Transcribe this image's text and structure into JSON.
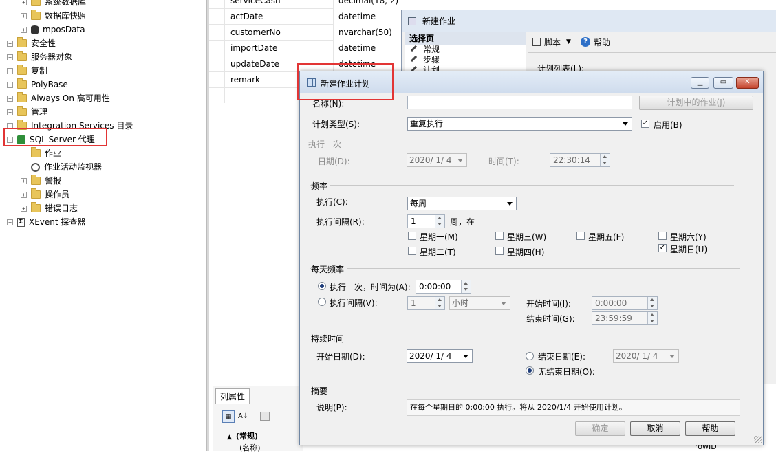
{
  "tree": {
    "items": [
      {
        "label": "系统数据库",
        "indent": 1,
        "icon": "folder",
        "expand": "+"
      },
      {
        "label": "数据库快照",
        "indent": 1,
        "icon": "folder",
        "expand": "+"
      },
      {
        "label": "mposData",
        "indent": 1,
        "icon": "database",
        "expand": "+"
      },
      {
        "label": "安全性",
        "indent": 0,
        "icon": "folder",
        "expand": "+"
      },
      {
        "label": "服务器对象",
        "indent": 0,
        "icon": "folder",
        "expand": "+"
      },
      {
        "label": "复制",
        "indent": 0,
        "icon": "folder",
        "expand": "+"
      },
      {
        "label": "PolyBase",
        "indent": 0,
        "icon": "folder",
        "expand": "+"
      },
      {
        "label": "Always On 高可用性",
        "indent": 0,
        "icon": "folder",
        "expand": "+"
      },
      {
        "label": "管理",
        "indent": 0,
        "icon": "folder",
        "expand": "+"
      },
      {
        "label": "Integration Services 目录",
        "indent": 0,
        "icon": "folder",
        "expand": "+"
      },
      {
        "label": "SQL Server 代理",
        "indent": 0,
        "icon": "agent",
        "expand": "-"
      },
      {
        "label": "作业",
        "indent": 1,
        "icon": "folder",
        "expand": ""
      },
      {
        "label": "作业活动监视器",
        "indent": 1,
        "icon": "monitor",
        "expand": ""
      },
      {
        "label": "警报",
        "indent": 1,
        "icon": "folder",
        "expand": "+"
      },
      {
        "label": "操作员",
        "indent": 1,
        "icon": "folder",
        "expand": "+"
      },
      {
        "label": "错误日志",
        "indent": 1,
        "icon": "folder",
        "expand": "+"
      },
      {
        "label": "XEvent 探查器",
        "indent": 0,
        "icon": "xevent",
        "expand": "+"
      }
    ]
  },
  "grid": {
    "rows": [
      {
        "name": "serviceCash",
        "type": "decimal(18, 2)"
      },
      {
        "name": "actDate",
        "type": "datetime"
      },
      {
        "name": "customerNo",
        "type": "nvarchar(50)"
      },
      {
        "name": "importDate",
        "type": "datetime"
      },
      {
        "name": "updateDate",
        "type": "datetime"
      },
      {
        "name": "remark",
        "type": ""
      }
    ]
  },
  "back_dialog": {
    "title": "新建作业",
    "select_page": "选择页",
    "pages": [
      "常规",
      "步骤",
      "计划"
    ],
    "toolbar_script": "脚本",
    "toolbar_help": "帮助",
    "schedule_list": "计划列表(L):"
  },
  "props": {
    "tab": "列属性",
    "section": "(常规)",
    "name_row": "(名称)",
    "right_value": "rowID"
  },
  "dialog": {
    "title": "新建作业计划",
    "name_label": "名称(N):",
    "name_value": "",
    "jobs_in_schedule": "计划中的作业(J)",
    "schedule_type_label": "计划类型(S):",
    "schedule_type_value": "重复执行",
    "enabled_label": "启用(B)",
    "enabled_checked": true,
    "once_group": "执行一次",
    "once_date_label": "日期(D):",
    "once_date_value": "2020/ 1/ 4",
    "once_time_label": "时间(T):",
    "once_time_value": "22:30:14",
    "freq_group": "频率",
    "occurs_label": "执行(C):",
    "occurs_value": "每周",
    "recurs_label": "执行间隔(R):",
    "recurs_value": "1",
    "recurs_unit": "周，在",
    "days": [
      {
        "label": "星期一(M)",
        "checked": false
      },
      {
        "label": "星期三(W)",
        "checked": false
      },
      {
        "label": "星期五(F)",
        "checked": false
      },
      {
        "label": "星期六(Y)",
        "checked": false
      },
      {
        "label": "星期二(T)",
        "checked": false
      },
      {
        "label": "星期四(H)",
        "checked": false
      },
      {
        "label": "星期日(U)",
        "checked": true
      }
    ],
    "daily_group": "每天频率",
    "daily_once_label": "执行一次，时间为(A):",
    "daily_once_value": "0:00:00",
    "daily_interval_label": "执行间隔(V):",
    "daily_interval_value": "1",
    "daily_interval_unit": "小时",
    "start_time_label": "开始时间(I):",
    "start_time_value": "0:00:00",
    "end_time_label": "结束时间(G):",
    "end_time_value": "23:59:59",
    "duration_group": "持续时间",
    "start_date_label": "开始日期(D):",
    "start_date_value": "2020/ 1/ 4",
    "end_date_label": "结束日期(E):",
    "end_date_value": "2020/ 1/ 4",
    "no_end_label": "无结束日期(O):",
    "summary_group": "摘要",
    "desc_label": "说明(P):",
    "desc_value": "在每个星期日的 0:00:00 执行。将从 2020/1/4 开始使用计划。",
    "ok": "确定",
    "cancel": "取消",
    "help": "帮助"
  },
  "colors": {
    "highlight": "#e23535",
    "title_bar": "#dfe8f3"
  }
}
